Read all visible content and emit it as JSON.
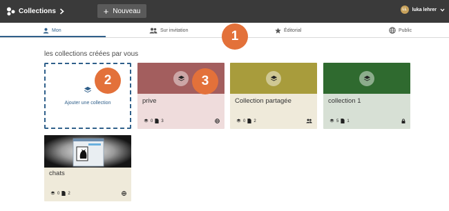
{
  "header": {
    "brand_label": "Collections",
    "new_button_label": "Nouveau",
    "user_initials": "LL",
    "user_name": "luka lehrer"
  },
  "tabs": [
    {
      "label": "Mon",
      "icon": "person-icon",
      "active": true
    },
    {
      "label": "Sur invitation",
      "icon": "people-icon",
      "active": false
    },
    {
      "label": "Éditorial",
      "icon": "star-icon",
      "active": false
    },
    {
      "label": "Public",
      "icon": "globe-icon",
      "active": false
    }
  ],
  "section_title": "les collections créées par vous",
  "add_collection_label": "Ajouter une collection",
  "collections": [
    {
      "title": "prive",
      "sub_collections": "0",
      "items": "3",
      "visibility_icon": "globe-icon",
      "color": "#a35e5e",
      "body_color": "#efdcdc"
    },
    {
      "title": "Collection partagée",
      "sub_collections": "0",
      "items": "2",
      "visibility_icon": "people-icon",
      "color": "#a89c3c",
      "body_color": "#efeada"
    },
    {
      "title": "collection 1",
      "sub_collections": "5",
      "items": "1",
      "visibility_icon": "lock-icon",
      "color": "#2f6a2f",
      "body_color": "#d7e0d5"
    },
    {
      "title": "chats",
      "sub_collections": "0",
      "items": "2",
      "visibility_icon": "globe-icon",
      "color": "#1a1a1a",
      "body_color": "#efeada"
    }
  ],
  "callouts": [
    "1",
    "2",
    "3"
  ],
  "colors": {
    "accent": "#2f5f8a",
    "callout": "#e3713a",
    "topbar": "#3a3a3a"
  }
}
